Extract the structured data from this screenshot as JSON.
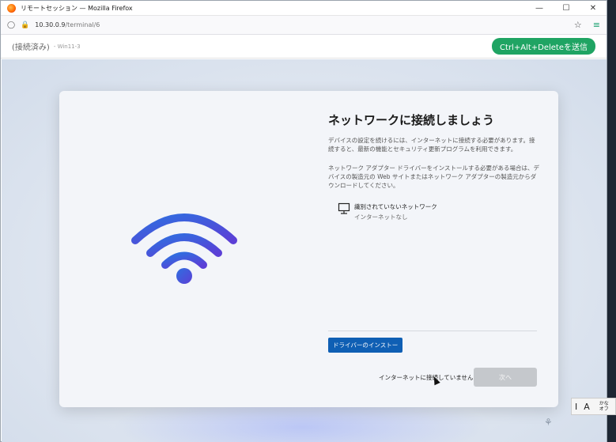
{
  "browser": {
    "title": "リモートセッション — Mozilla Firefox",
    "url_host": "10.30.0.9",
    "url_path": "/terminal/6"
  },
  "session": {
    "status": "(接続済み)",
    "host": "- Win11-3",
    "cad_button": "Ctrl+Alt+Deleteを送信"
  },
  "oobe": {
    "heading": "ネットワークに接続しましょう",
    "paragraph1": "デバイスの設定を続けるには、インターネットに接続する必要があります。接続すると、最新の機能とセキュリティ更新プログラムを利用できます。",
    "paragraph2": "ネットワーク アダプター ドライバーをインストールする必要がある場合は、デバイスの製造元の Web サイトまたはネットワーク アダプターの製造元からダウンロードしてください。",
    "network_name": "識別されていないネットワーク",
    "network_state": "インターネットなし",
    "driver_button": "ドライバーのインストー",
    "no_internet_link": "インターネットに接続していません",
    "next_button": "次へ"
  },
  "ime": {
    "mode1": "I",
    "mode2": "A",
    "mode3a": "かな",
    "mode3b": "オフ"
  },
  "colors": {
    "accent": "#1fa463",
    "wifi_gradient_start": "#2f6fe0",
    "wifi_gradient_end": "#5b3fd6",
    "driver_button_bg": "#0f5fb4"
  }
}
